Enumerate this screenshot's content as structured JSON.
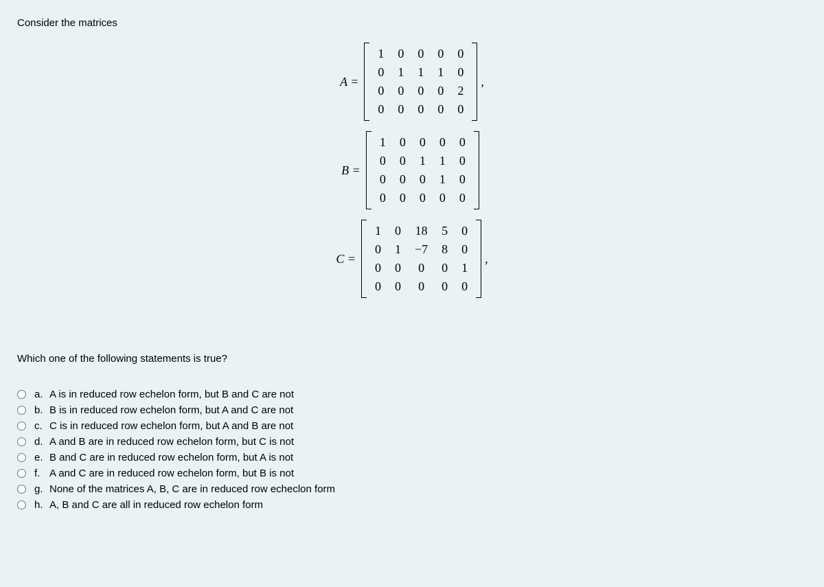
{
  "intro": "Consider the matrices",
  "matrices": {
    "A": {
      "label": "A =",
      "rows": [
        [
          "1",
          "0",
          "0",
          "0",
          "0"
        ],
        [
          "0",
          "1",
          "1",
          "1",
          "0"
        ],
        [
          "0",
          "0",
          "0",
          "0",
          "2"
        ],
        [
          "0",
          "0",
          "0",
          "0",
          "0"
        ]
      ],
      "trailing": ","
    },
    "B": {
      "label": "B =",
      "rows": [
        [
          "1",
          "0",
          "0",
          "0",
          "0"
        ],
        [
          "0",
          "0",
          "1",
          "1",
          "0"
        ],
        [
          "0",
          "0",
          "0",
          "1",
          "0"
        ],
        [
          "0",
          "0",
          "0",
          "0",
          "0"
        ]
      ],
      "trailing": ""
    },
    "C": {
      "label": "C =",
      "rows": [
        [
          "1",
          "0",
          "18",
          "5",
          "0"
        ],
        [
          "0",
          "1",
          "−7",
          "8",
          "0"
        ],
        [
          "0",
          "0",
          "0",
          "0",
          "1"
        ],
        [
          "0",
          "0",
          "0",
          "0",
          "0"
        ]
      ],
      "trailing": ","
    }
  },
  "question": "Which one of the following statements is true?",
  "options": [
    {
      "letter": "a.",
      "text": "A is in reduced row echelon form, but B and C are not"
    },
    {
      "letter": "b.",
      "text": "B is in reduced row echelon form, but A and C are not"
    },
    {
      "letter": "c.",
      "text": "C is in reduced row echelon form, but A and B are not"
    },
    {
      "letter": "d.",
      "text": "A and B are in reduced row echelon form, but C is not"
    },
    {
      "letter": "e.",
      "text": "B and C are in reduced row echelon form, but A is not"
    },
    {
      "letter": "f.",
      "text": "A and C are in reduced row echelon form, but B is not"
    },
    {
      "letter": "g.",
      "text": "None of the matrices A, B, C are in reduced row echeclon form"
    },
    {
      "letter": "h.",
      "text": "A, B and C are all in reduced row echelon form"
    }
  ]
}
